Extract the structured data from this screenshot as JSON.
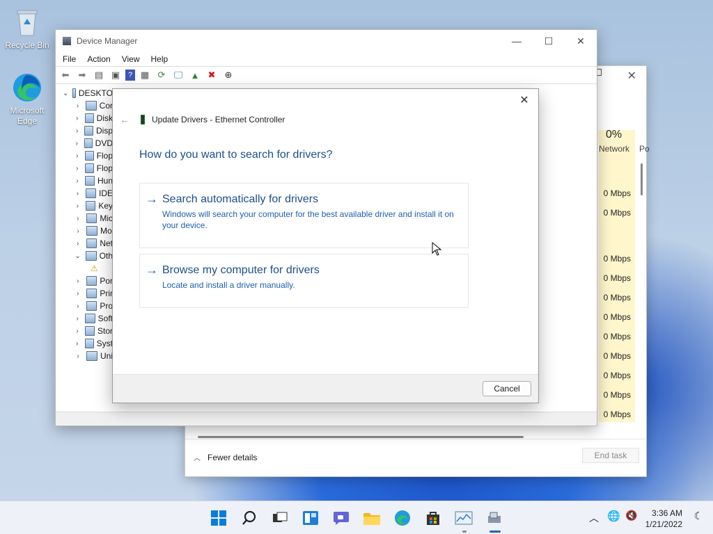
{
  "desktop": {
    "icons": [
      {
        "label": "Recycle Bin"
      },
      {
        "label": "Microsoft Edge"
      }
    ]
  },
  "device_manager": {
    "title": "Device Manager",
    "menu": [
      "File",
      "Action",
      "View",
      "Help"
    ],
    "tree_root": "DESKTO",
    "tree": [
      "Cor",
      "Disk",
      "Disp",
      "DVD",
      "Flop",
      "Flop",
      "Hun",
      "IDE",
      "Key",
      "Mic",
      "Mo",
      "Net",
      "Oth",
      "",
      "Por",
      "Prir",
      "Pro",
      "Soft",
      "Stor",
      "Syst",
      "Uni"
    ]
  },
  "task_manager": {
    "percent": "0%",
    "column": "Network",
    "column2": "Po",
    "values": [
      "0 Mbps",
      "0 Mbps",
      "0 Mbps",
      "0 Mbps",
      "0 Mbps",
      "0 Mbps",
      "0 Mbps",
      "0 Mbps",
      "0 Mbps",
      "0 Mbps",
      "0 Mbps"
    ],
    "fewer_details": "Fewer details",
    "end_task": "End task"
  },
  "dialog": {
    "title": "Update Drivers - Ethernet Controller",
    "question": "How do you want to search for drivers?",
    "options": [
      {
        "title": "Search automatically for drivers",
        "desc": "Windows will search your computer for the best available driver and install it on your device."
      },
      {
        "title": "Browse my computer for drivers",
        "desc": "Locate and install a driver manually."
      }
    ],
    "cancel": "Cancel",
    "close": "✕",
    "arrow": "→",
    "back": "←"
  },
  "taskbar": {
    "time": "3:36 AM",
    "date": "1/21/2022"
  },
  "colors": {
    "accent": "#1c5fb0",
    "link": "#1c4f8c"
  }
}
